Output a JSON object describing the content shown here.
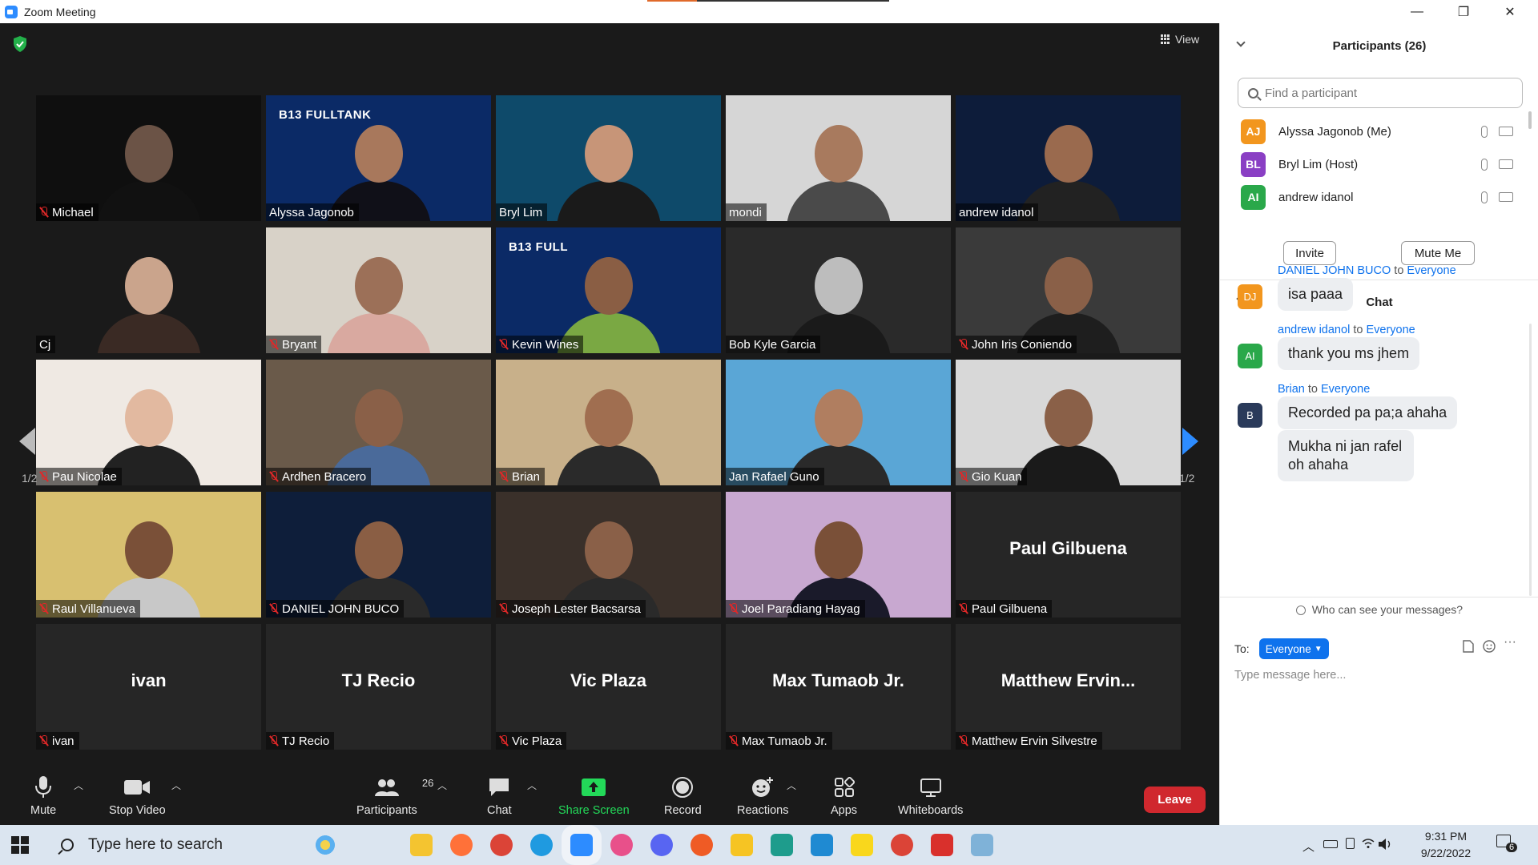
{
  "window": {
    "title": "Zoom Meeting",
    "minimize_glyph": "—",
    "restore_glyph": "❐",
    "close_glyph": "✕"
  },
  "meeting": {
    "view_label": "View",
    "page_indicator": "1/2",
    "security_icon": "shield-check-icon",
    "tiles": [
      {
        "name": "Michael",
        "muted": true,
        "video": true,
        "bg": "#0f0f0f",
        "skin": "#6b5346",
        "shirt": "#111111"
      },
      {
        "name": "Alyssa Jagonob",
        "muted": false,
        "video": true,
        "active": true,
        "bg": "#0b2a66",
        "skin": "#a8785c",
        "shirt": "#101018",
        "overlay": "B13 FULLTANK"
      },
      {
        "name": "Bryl Lim",
        "muted": false,
        "video": true,
        "bg": "#0e4a6a",
        "skin": "#c79578",
        "shirt": "#1a1a1a"
      },
      {
        "name": "mondi",
        "muted": false,
        "video": true,
        "bg": "#d6d6d6",
        "skin": "#a87a5e",
        "shirt": "#4a4a4a"
      },
      {
        "name": "andrew idanol",
        "muted": false,
        "video": true,
        "bg": "#0d1c3a",
        "skin": "#9a6a4e",
        "shirt": "#222222"
      },
      {
        "name": "Cj",
        "muted": false,
        "video": true,
        "bg": "#1a1a1a",
        "skin": "#caa48c",
        "shirt": "#3a2a24"
      },
      {
        "name": "Bryant",
        "muted": true,
        "video": true,
        "bg": "#d8d2c8",
        "skin": "#9c7058",
        "shirt": "#d9a9a0"
      },
      {
        "name": "Kevin Wines",
        "muted": true,
        "video": true,
        "bg": "#0b2a66",
        "skin": "#8a5e44",
        "shirt": "#7aa843",
        "overlay": "B13 FULL"
      },
      {
        "name": "Bob Kyle Garcia",
        "muted": false,
        "video": true,
        "bg": "#2a2a2a",
        "skin": "#bdbdbd",
        "shirt": "#1a1a1a"
      },
      {
        "name": "John Iris Coniendo",
        "muted": true,
        "video": true,
        "bg": "#3a3a3a",
        "skin": "#8a6048",
        "shirt": "#1e1e1e"
      },
      {
        "name": "Pau Nicolae",
        "muted": true,
        "video": true,
        "bg": "#efe9e3",
        "skin": "#e2b9a0",
        "shirt": "#222222"
      },
      {
        "name": "Ardhen Bracero",
        "muted": true,
        "video": true,
        "bg": "#6a5a4a",
        "skin": "#8a6048",
        "shirt": "#4a6a9a"
      },
      {
        "name": "Brian",
        "muted": true,
        "video": true,
        "bg": "#c8b08a",
        "skin": "#a06e50",
        "shirt": "#2a2a2a"
      },
      {
        "name": "Jan Rafael Guno",
        "muted": false,
        "video": true,
        "bg": "#5aa6d6",
        "skin": "#b07e60",
        "shirt": "#2a2a2a"
      },
      {
        "name": "Gio Kuan",
        "muted": true,
        "video": true,
        "bg": "#d8d8d8",
        "skin": "#8a6048",
        "shirt": "#1a1a1a"
      },
      {
        "name": "Raul Villanueva",
        "muted": true,
        "video": true,
        "bg": "#d8c070",
        "skin": "#7a5038",
        "shirt": "#c8c8c8"
      },
      {
        "name": "DANIEL JOHN BUCO",
        "muted": true,
        "video": true,
        "bg": "#0e1e3a",
        "skin": "#8a5e44",
        "shirt": "#2a2a2a"
      },
      {
        "name": "Joseph Lester Bacsarsa",
        "muted": true,
        "video": true,
        "bg": "#3a302a",
        "skin": "#8a6048",
        "shirt": "#2a2a2a"
      },
      {
        "name": "Joel Paradiang Hayag",
        "muted": true,
        "video": true,
        "bg": "#c8a8d0",
        "skin": "#7a5038",
        "shirt": "#1a1a2a"
      },
      {
        "name": "Paul Gilbuena",
        "muted": true,
        "video": false,
        "display": "Paul Gilbuena"
      },
      {
        "name": "ivan",
        "muted": true,
        "video": false,
        "display": "ivan"
      },
      {
        "name": "TJ Recio",
        "muted": true,
        "video": false,
        "display": "TJ Recio"
      },
      {
        "name": "Vic Plaza",
        "muted": true,
        "video": false,
        "display": "Vic Plaza"
      },
      {
        "name": "Max Tumaob Jr.",
        "muted": true,
        "video": false,
        "display": "Max Tumaob Jr."
      },
      {
        "name": "Matthew Ervin Silvestre",
        "muted": true,
        "video": false,
        "display": "Matthew  Ervin..."
      }
    ]
  },
  "toolbar": {
    "mute": "Mute",
    "stop_video": "Stop Video",
    "participants": "Participants",
    "participants_count": "26",
    "chat": "Chat",
    "share_screen": "Share Screen",
    "record": "Record",
    "reactions": "Reactions",
    "apps": "Apps",
    "whiteboards": "Whiteboards",
    "leave": "Leave",
    "share_color": "#23d959",
    "leave_color": "#d0282e"
  },
  "participants_panel": {
    "title": "Participants (26)",
    "search_placeholder": "Find a participant",
    "list": [
      {
        "initials": "AJ",
        "name": "Alyssa Jagonob (Me)",
        "color": "#f2961e"
      },
      {
        "initials": "BL",
        "name": "Bryl Lim (Host)",
        "color": "#8a3fc4"
      },
      {
        "initials": "AI",
        "name": "andrew idanol",
        "color": "#2aa84a"
      }
    ],
    "invite": "Invite",
    "mute_me": "Mute Me"
  },
  "chat_panel": {
    "title": "Chat",
    "messages": [
      {
        "sender": "DANIEL JOHN BUCO",
        "to": "to",
        "recipient": "Everyone",
        "initials": "DJ",
        "color": "#f2961e",
        "texts": [
          "isa paaa"
        ]
      },
      {
        "sender": "andrew idanol",
        "to": "to",
        "recipient": "Everyone",
        "initials": "AI",
        "color": "#2aa84a",
        "texts": [
          "thank you ms jhem"
        ]
      },
      {
        "sender": "Brian",
        "to": "to",
        "recipient": "Everyone",
        "initials": "B",
        "color": "#2a3a5a",
        "texts": [
          "Recorded pa pa;a ahaha",
          "Mukha ni jan rafel oh ahaha"
        ]
      }
    ],
    "privacy": "Who can see your messages?",
    "to_label": "To:",
    "to_value": "Everyone",
    "input_placeholder": "Type message here...",
    "more_glyph": "···"
  },
  "taskbar": {
    "search_placeholder": "Type here to search",
    "time": "9:31 PM",
    "date": "9/22/2022",
    "notification_count": "6",
    "apps": [
      {
        "name": "file-explorer-icon",
        "color": "#f4c430"
      },
      {
        "name": "firefox-icon",
        "color": "#ff7139"
      },
      {
        "name": "chrome-icon",
        "color": "#db4437"
      },
      {
        "name": "edge-icon",
        "color": "#1f9ae0"
      },
      {
        "name": "zoom-icon",
        "color": "#2d8cff"
      },
      {
        "name": "osu-icon",
        "color": "#e8508a"
      },
      {
        "name": "discord-icon",
        "color": "#5865f2"
      },
      {
        "name": "postman-icon",
        "color": "#ef5b25"
      },
      {
        "name": "notes-icon",
        "color": "#f6c423"
      },
      {
        "name": "pycharm-icon",
        "color": "#1e9c8c"
      },
      {
        "name": "vscode-icon",
        "color": "#1f8ad2"
      },
      {
        "name": "sticky-notes-icon",
        "color": "#f9d71c"
      },
      {
        "name": "chrome-profile-icon",
        "color": "#db4437"
      },
      {
        "name": "vivaldi-icon",
        "color": "#d9302c"
      },
      {
        "name": "paint-icon",
        "color": "#7fb2d8"
      }
    ]
  }
}
